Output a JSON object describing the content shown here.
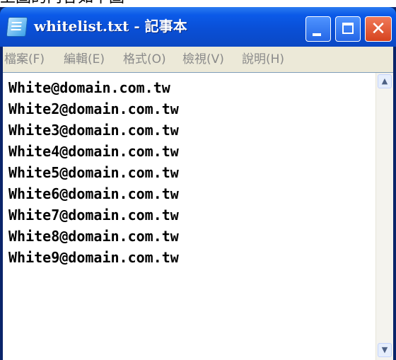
{
  "caption_fragment": "上圖的內容如下圖",
  "window": {
    "title": "whitelist.txt - 記事本",
    "icon": "notepad-icon",
    "buttons": {
      "minimize": "minimize-icon",
      "maximize": "maximize-icon",
      "close_glyph": "✕"
    }
  },
  "menu": {
    "items": [
      "檔案(F)",
      "編輯(E)",
      "格式(O)",
      "檢視(V)",
      "說明(H)"
    ]
  },
  "document": {
    "lines": [
      "White@domain.com.tw",
      "White2@domain.com.tw",
      "White3@domain.com.tw",
      "White4@domain.com.tw",
      "White5@domain.com.tw",
      "White6@domain.com.tw",
      "White7@domain.com.tw",
      "White8@domain.com.tw",
      "White9@domain.com.tw"
    ]
  },
  "scrollbar": {
    "up_glyph": "▲",
    "down_glyph": "▼"
  }
}
